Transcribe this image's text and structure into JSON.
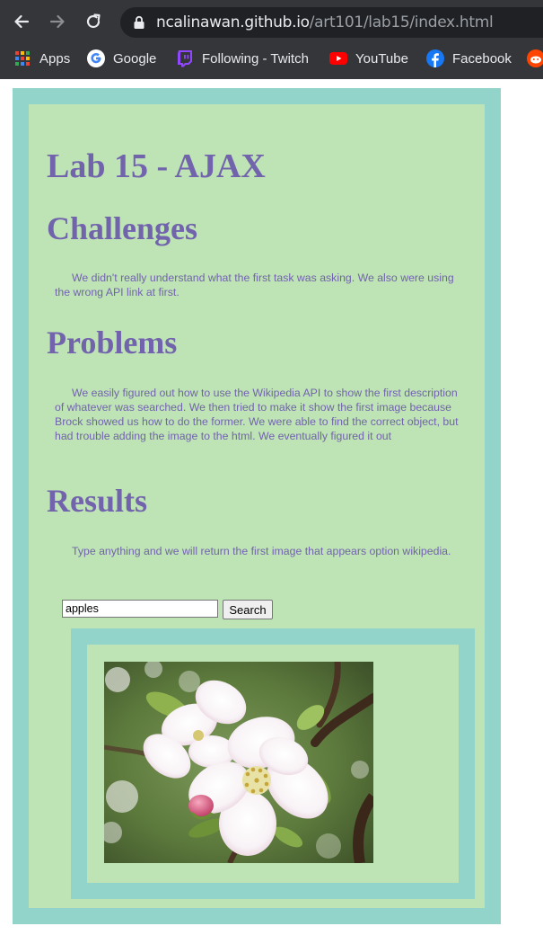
{
  "browser": {
    "url_host": "ncalinawan.github.io",
    "url_path": "/art101/lab15/index.html",
    "bookmarks": [
      {
        "label": "Apps",
        "icon": "apps-grid-icon"
      },
      {
        "label": "Google",
        "icon": "google-icon"
      },
      {
        "label": "Following - Twitch",
        "icon": "twitch-icon"
      },
      {
        "label": "YouTube",
        "icon": "youtube-icon"
      },
      {
        "label": "Facebook",
        "icon": "facebook-icon"
      },
      {
        "label": "",
        "icon": "reddit-icon"
      }
    ],
    "chrome_color": "#35363a"
  },
  "page": {
    "title": "Lab 15 - AJAX",
    "sections": [
      {
        "heading": "Challenges",
        "text": "We didn't really understand what the first task was asking. We also were using the wrong API link at first."
      },
      {
        "heading": "Problems",
        "text": "We easily figured out how to use the Wikipedia API to show the first description of whatever was searched. We then tried to make it show the first image because Brock showed us how to do the former. We were able to find the correct object, but had trouble adding the image to the html. We eventually figured it out"
      },
      {
        "heading": "Results",
        "text": "Type anything and we will return the first image that appears option wikipedia."
      }
    ],
    "search": {
      "value": "apples",
      "button_label": "Search"
    },
    "result_image": {
      "alt": "apple blossom"
    },
    "colors": {
      "outer_border": "#93d4ca",
      "inner_background": "#bee3b5",
      "text": "#7263ad"
    }
  }
}
